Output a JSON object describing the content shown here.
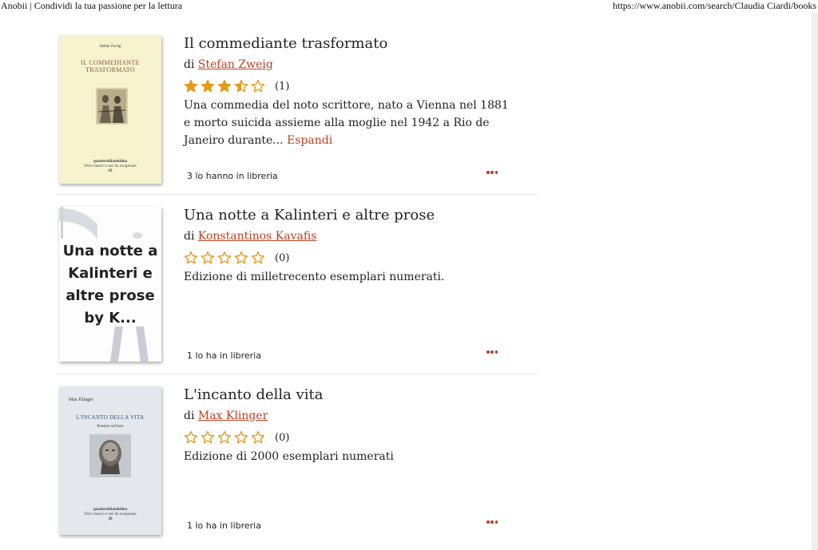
{
  "page": {
    "print_title": "Anobii | Condividi la tua passione per la lettura",
    "print_url": "https://www.anobii.com/search/Claudia Ciardi/books"
  },
  "colors": {
    "accent": "#b8411e",
    "star": "#e39b1b",
    "divider": "#e3e3e3"
  },
  "labels": {
    "by": "di",
    "expand": "Espandi"
  },
  "books": [
    {
      "title": "Il commediante trasformato",
      "author": "Stefan Zweig",
      "rating": 3.5,
      "rating_count": "(1)",
      "description": "Una commedia del noto scrittore, nato a Vienna nel 1881 e morto suicida assieme alla moglie nel 1942 a Rio de Janeiro durante...",
      "library_count": "3 lo hanno in libreria",
      "cover": {
        "author": "Stefan Zweig",
        "title_line1": "IL COMMEDIANTE",
        "title_line2": "TRASFORMATO",
        "publisher": "quadernidiandulina",
        "publisher_sub": "Testi classici e rari da recuperare",
        "number": "43"
      }
    },
    {
      "title": "Una notte a Kalinteri e altre prose",
      "author": "Konstantinos Kavafis",
      "rating": 0,
      "rating_count": "(0)",
      "description": "Edizione di milletrecento esemplari numerati.",
      "library_count": "1 lo ha in libreria",
      "cover": {
        "placeholder_text": "Una notte a Kalinteri e altre prose by K..."
      }
    },
    {
      "title": "L'incanto della vita",
      "author": "Max Klinger",
      "rating": 0,
      "rating_count": "(0)",
      "description": "Edizione di 2000 esemplari numerati",
      "library_count": "1 lo ha in libreria",
      "cover": {
        "author": "Max Klinger",
        "title": "L'INCANTO DELLA VITA",
        "subtitle": "Pensieri sull'arte",
        "publisher": "quadernidiandulina",
        "publisher_sub": "Testi classici e rari da recuperare",
        "number": "28"
      }
    }
  ]
}
